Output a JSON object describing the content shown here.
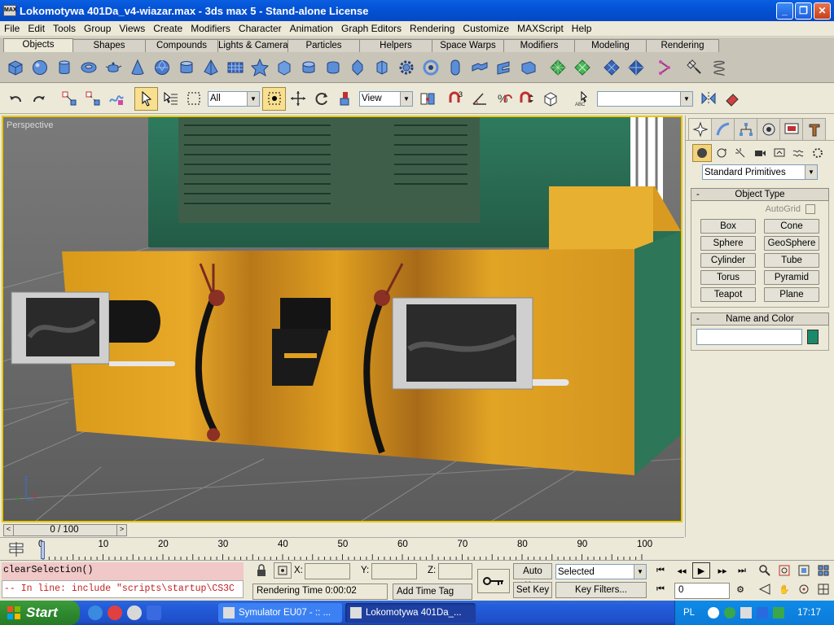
{
  "window": {
    "title": "Lokomotywa 401Da_v4-wiazar.max - 3ds max 5 - Stand-alone License",
    "app_icon_text": "MAX"
  },
  "menu": [
    "File",
    "Edit",
    "Tools",
    "Group",
    "Views",
    "Create",
    "Modifiers",
    "Character",
    "Animation",
    "Graph Editors",
    "Rendering",
    "Customize",
    "MAXScript",
    "Help"
  ],
  "tabs": [
    "Objects",
    "Shapes",
    "Compounds",
    "Lights & Cameras",
    "Particles",
    "Helpers",
    "Space Warps",
    "Modifiers",
    "Modeling",
    "Rendering"
  ],
  "active_tab": "Objects",
  "toolbar": {
    "selection_filter": "All",
    "ref_coord": "View",
    "named_selection": ""
  },
  "viewport": {
    "label": "Perspective",
    "axis_x": "x",
    "axis_y": "y",
    "axis_z": "z"
  },
  "command_panel": {
    "category": "Standard Primitives",
    "object_type_title": "Object Type",
    "autogrid_label": "AutoGrid",
    "buttons": [
      "Box",
      "Cone",
      "Sphere",
      "GeoSphere",
      "Cylinder",
      "Tube",
      "Torus",
      "Pyramid",
      "Teapot",
      "Plane"
    ],
    "name_color_title": "Name and Color",
    "name_value": "",
    "object_color": "#1a8a6a"
  },
  "timeline": {
    "slider_label": "0 / 100",
    "ticks": [
      "0",
      "10",
      "20",
      "30",
      "40",
      "50",
      "60",
      "70",
      "80",
      "90",
      "100"
    ]
  },
  "status": {
    "listener_line1": "clearSelection()",
    "listener_line2": "-- In line: include \"scripts\\startup\\CS3C",
    "x_label": "X:",
    "y_label": "Y:",
    "z_label": "Z:",
    "prompt": "Rendering Time  0:00:02",
    "add_time_tag": "Add Time Tag",
    "auto_key": "Auto Key",
    "set_key": "Set Key",
    "selected": "Selected",
    "key_filters": "Key Filters...",
    "frame": "0"
  },
  "taskbar": {
    "start": "Start",
    "tasks": [
      "Symulator EU07 - :: ...",
      "Lokomotywa 401Da_..."
    ],
    "lang": "PL",
    "clock": "17:17"
  },
  "colors": {
    "locomotive_body": "#e0a020",
    "locomotive_top": "#2a6e54",
    "viewport_bg": "#6b6b6b",
    "highlight": "#e8c800"
  }
}
